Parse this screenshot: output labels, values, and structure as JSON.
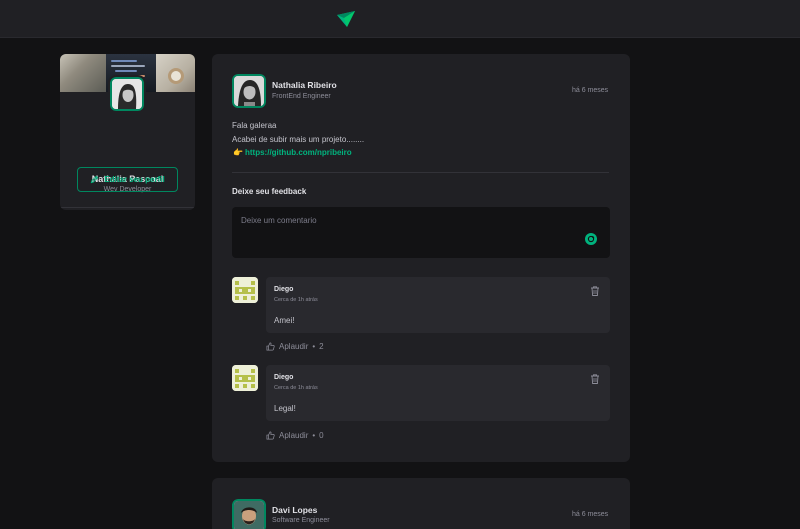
{
  "sidebar": {
    "name": "Nathalia Pascoal",
    "role": "Wev Developer",
    "edit_label": "Editar seu perfil"
  },
  "post1": {
    "author": "Nathalia Ribeiro",
    "role": "FrontEnd Engineer",
    "time": "há 6 meses",
    "lines": [
      "Fala galeraa",
      "Acabei de subir mais um projeto........"
    ],
    "link_emoji": "👉",
    "link": "https://github.com/npribeiro",
    "feedback_title": "Deixe seu feedback",
    "comment_placeholder": "Deixe um comentario",
    "comments": [
      {
        "author": "Diego",
        "time": "Cerca de 1h atrás",
        "text": "Amei!",
        "applaud_label": "Aplaudir",
        "applaud_count": "2"
      },
      {
        "author": "Diego",
        "time": "Cerca de 1h atrás",
        "text": "Legal!",
        "applaud_label": "Aplaudir",
        "applaud_count": "0"
      }
    ]
  },
  "post2": {
    "author": "Davi Lopes",
    "role": "Software Engineer",
    "time": "há 6 meses"
  },
  "colors": {
    "background": "#121214",
    "card": "#202024",
    "comment_card": "#29292e",
    "accent": "#00b37e",
    "accent_dark": "#00875f"
  }
}
